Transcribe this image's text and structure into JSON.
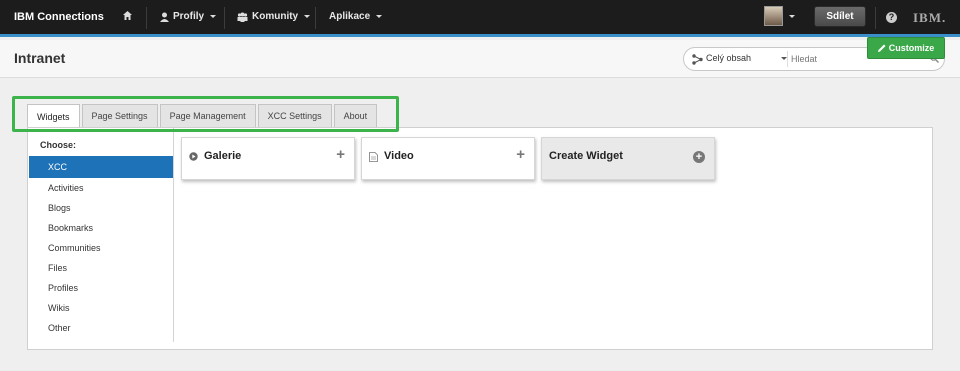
{
  "topbar": {
    "brand": "IBM Connections",
    "nav": [
      {
        "label": "Profily"
      },
      {
        "label": "Komunity"
      },
      {
        "label": "Aplikace"
      }
    ],
    "share_label": "Sdílet",
    "help_glyph": "?",
    "ibm_logo_text": "IBM."
  },
  "header": {
    "title": "Intranet",
    "search_scope": "Celý obsah",
    "search_placeholder": "Hledat",
    "customize_label": "Customize"
  },
  "tabs": [
    {
      "label": "Widgets",
      "active": true
    },
    {
      "label": "Page Settings"
    },
    {
      "label": "Page Management"
    },
    {
      "label": "XCC Settings"
    },
    {
      "label": "About"
    }
  ],
  "sidebar": {
    "heading": "Choose:",
    "items": [
      "XCC",
      "Activities",
      "Blogs",
      "Bookmarks",
      "Communities",
      "Files",
      "Profiles",
      "Wikis",
      "Other"
    ],
    "selected": "XCC"
  },
  "widgets": [
    {
      "label": "Galerie",
      "icon": "play-circle-icon",
      "action": "+"
    },
    {
      "label": "Video",
      "icon": "document-icon",
      "action": "+"
    },
    {
      "label": "Create Widget",
      "icon": "add-circle-icon",
      "action": "+"
    }
  ],
  "colors": {
    "topbar_bg": "#1c1c1c",
    "accent_blue": "#1d72b8",
    "customize_green": "#3aa848",
    "highlight_green": "#3cb44b"
  }
}
